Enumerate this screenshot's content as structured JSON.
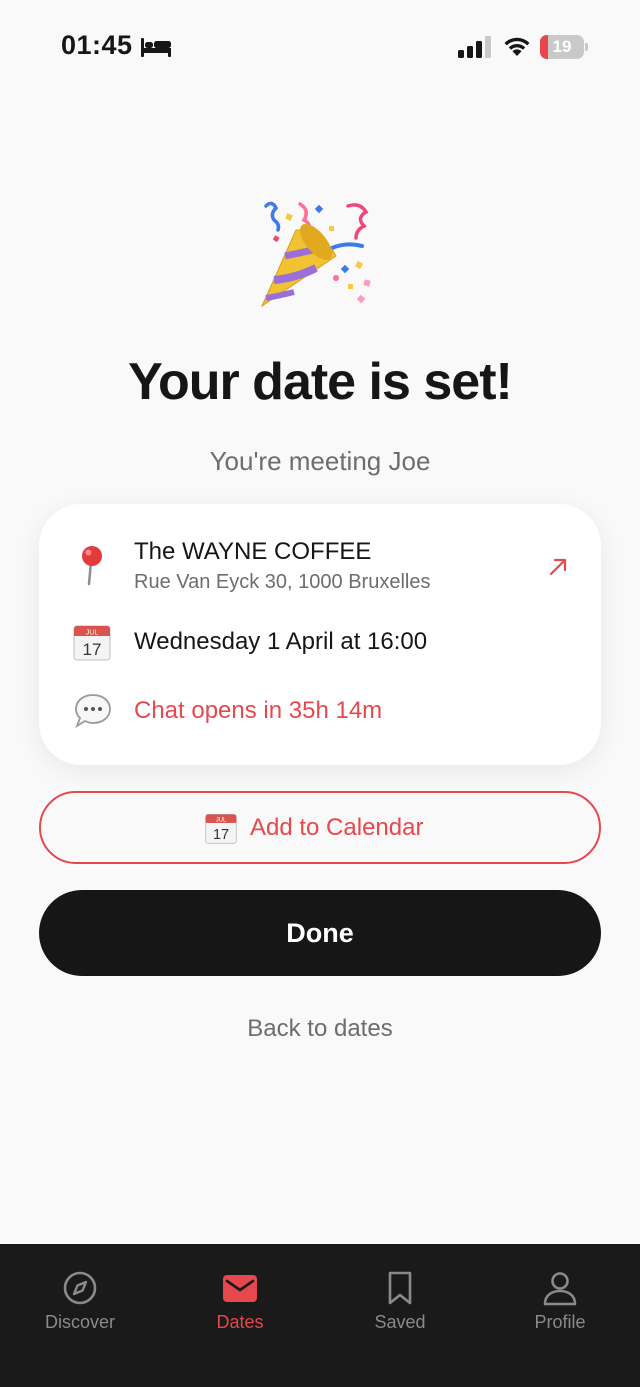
{
  "status_bar": {
    "time": "01:45",
    "battery_level": "19",
    "battery_fraction": 0.19,
    "icons": [
      "bed-icon",
      "cellular-signal-icon",
      "wifi-icon",
      "battery-icon"
    ]
  },
  "hero": {
    "icon": "party-popper-icon",
    "title": "Your date is set!",
    "subtitle": "You're meeting Joe"
  },
  "details_card": {
    "venue": {
      "icon": "pin-icon",
      "name": "The WAYNE COFFEE",
      "address": "Rue Van Eyck 30, 1000 Bruxelles",
      "action_icon": "open-external-arrow-icon"
    },
    "datetime": {
      "icon": "calendar-icon",
      "calendar_icon_month": "JUL",
      "calendar_icon_day": "17",
      "text": "Wednesday 1 April at 16:00"
    },
    "chat": {
      "icon": "speech-bubble-icon",
      "text": "Chat opens in 35h 14m"
    }
  },
  "actions": {
    "add_to_calendar": {
      "icon": "calendar-icon",
      "label": "Add to Calendar"
    },
    "done_label": "Done",
    "back_label": "Back to dates"
  },
  "tab_bar": {
    "items": [
      {
        "label": "Discover",
        "icon": "compass-icon",
        "active": false
      },
      {
        "label": "Dates",
        "icon": "envelope-icon",
        "active": true
      },
      {
        "label": "Saved",
        "icon": "bookmark-icon",
        "active": false
      },
      {
        "label": "Profile",
        "icon": "person-icon",
        "active": false
      }
    ]
  },
  "colors": {
    "accent": "#e5484d",
    "background": "#f9f9f9",
    "primary_button": "#161616",
    "tab_bar_background": "#1a1a1a",
    "muted_text": "#6d6d6d"
  }
}
